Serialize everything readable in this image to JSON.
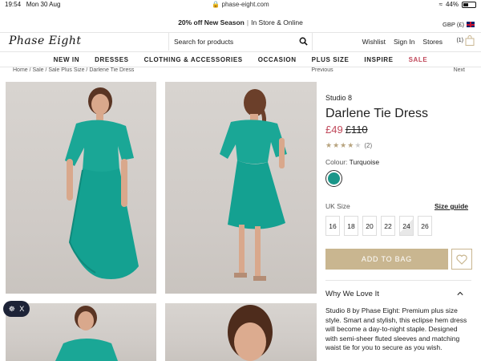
{
  "status_bar": {
    "time": "19:54",
    "date": "Mon 30 Aug",
    "url": "phase-eight.com",
    "battery": "44%",
    "battery_level": 0.44
  },
  "promo": {
    "highlight": "20% off New Season",
    "rest": "In Store & Online"
  },
  "currency": "GBP (£)",
  "header": {
    "logo": "Phase Eight",
    "search_placeholder": "Search for products",
    "links": {
      "wishlist": "Wishlist",
      "sign_in": "Sign In",
      "stores": "Stores"
    },
    "basket_count": "(1)"
  },
  "nav": [
    "NEW IN",
    "DRESSES",
    "CLOTHING & ACCESSORIES",
    "OCCASION",
    "PLUS SIZE",
    "INSPIRE",
    "SALE"
  ],
  "breadcrumb": "Home / Sale / Sale Plus Size / Darlene Tie Dress",
  "pager": {
    "prev": "Previous",
    "next": "Next"
  },
  "product": {
    "brand": "Studio 8",
    "name": "Darlene Tie Dress",
    "price_now": "£49",
    "price_was": "£110",
    "rating": 4,
    "rating_max": 5,
    "review_count": "(2)",
    "colour_label": "Colour:",
    "colour_value": "Turquoise",
    "colour_hex": "#1a9689",
    "size_label": "UK Size",
    "size_guide": "Size guide",
    "sizes": [
      "16",
      "18",
      "20",
      "22",
      "24",
      "26"
    ],
    "add_to_bag": "ADD TO BAG",
    "why_heading": "Why We Love It",
    "description": "Studio 8 by Phase Eight: Premium plus size style. Smart and stylish, this eclipse hem dress will become a day-to-night staple. Designed with semi-sheer fluted sleeves and matching waist tie for you to secure as you wish."
  },
  "accessibility": {
    "close": "X"
  }
}
